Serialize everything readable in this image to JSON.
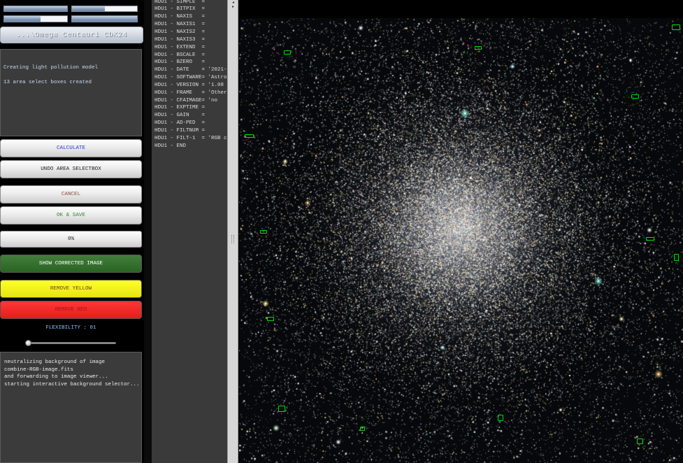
{
  "level_bars": [
    {
      "fill": 1.0
    },
    {
      "fill": 0.5
    },
    {
      "fill": 0.58
    },
    {
      "fill": 1.0
    }
  ],
  "file_title": "...\\Omega Centauri CDK24",
  "status_log": [
    "Creating light pollution model",
    "13 area select boxes created"
  ],
  "buttons": {
    "calculate": "CALCULATE",
    "undo": "UNDO AREA SELECTBOX",
    "cancel": "CANCEL",
    "ok_save": "OK & SAVE",
    "show_corrected": "SHOW CORRECTED IMAGE",
    "remove_yellow": "REMOVE YELLOW",
    "remove_red": "REMOVE RED"
  },
  "progress": {
    "label": "0%",
    "fill": 0
  },
  "flexibility": {
    "label": "FLEXIBILITY : 01",
    "slider_fraction": 0.02
  },
  "process_log": [
    "neutralizing background of image",
    "combine-RGB-image.fits",
    "and forwarding to image viewer...",
    "starting interactive background selector..."
  ],
  "fits_header": [
    "HDU1 - SIMPLE  =",
    "HDU1 - BITPIX  =",
    "HDU1 - NAXIS   =",
    "HDU1 - NAXIS1  =",
    "HDU1 - NAXIS2  =",
    "HDU1 - NAXIS3  =",
    "HDU1 - EXTEND  =",
    "HDU1 - BSCALE  =",
    "HDU1 - BZERO   =",
    "HDU1 - DATE    = '2021-",
    "HDU1 - SOFTWARE= 'Astro",
    "HDU1 - VERSION = '1.08",
    "HDU1 - FRAME   = 'Other",
    "HDU1 - CFAIMAGE= 'no",
    "HDU1 - EXPTIME =",
    "HDU1 - GAIN    =",
    "HDU1 - AD-PED  =",
    "HDU1 - FILTNUM =",
    "HDU1 - FILT-1  = 'RGB c",
    "HDU1 - END"
  ],
  "colors": {
    "calculate_text": "#2b35c4",
    "cancel_text": "#8b4a3c",
    "ok_save_text": "#2e8b2e",
    "show_corrected_bg": "#2e6f26",
    "show_corrected_text": "#ffffff",
    "remove_yellow_bg": "#ffff14",
    "remove_yellow_text": "#7a3d12",
    "remove_red_bg": "#ff2020",
    "remove_red_text": "#a51414",
    "flexibility_text": "#8ec6ff",
    "select_box": "#00e000"
  },
  "icons": {
    "splitter_collapse": "triangle-left-icon",
    "splitter_expand": "triangle-right-icon",
    "splitter_grip": "grip-icon"
  }
}
